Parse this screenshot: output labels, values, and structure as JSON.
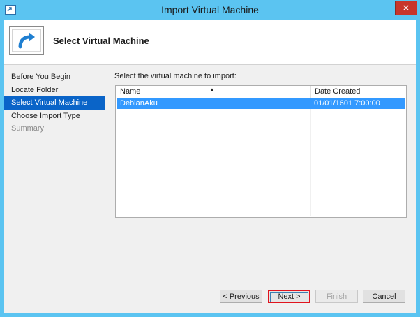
{
  "window": {
    "title": "Import Virtual Machine",
    "close_label": "✕"
  },
  "header": {
    "title": "Select Virtual Machine",
    "icon": "import-arrow-icon"
  },
  "steps": [
    {
      "label": "Before You Begin",
      "state": "normal"
    },
    {
      "label": "Locate Folder",
      "state": "normal"
    },
    {
      "label": "Select Virtual Machine",
      "state": "active"
    },
    {
      "label": "Choose Import Type",
      "state": "normal"
    },
    {
      "label": "Summary",
      "state": "disabled"
    }
  ],
  "main": {
    "prompt": "Select the virtual machine to import:",
    "columns": {
      "name": "Name",
      "date": "Date Created"
    },
    "sort_indicator": "▲",
    "rows": [
      {
        "name": "DebianAku",
        "date": "01/01/1601 7:00:00",
        "selected": true
      }
    ]
  },
  "buttons": {
    "previous": "< Previous",
    "next": "Next >",
    "finish": "Finish",
    "cancel": "Cancel"
  },
  "colors": {
    "titlebar": "#5bc4f1",
    "active_step": "#0a64c8",
    "selected_row": "#3399ff",
    "highlight": "#e0141e"
  }
}
